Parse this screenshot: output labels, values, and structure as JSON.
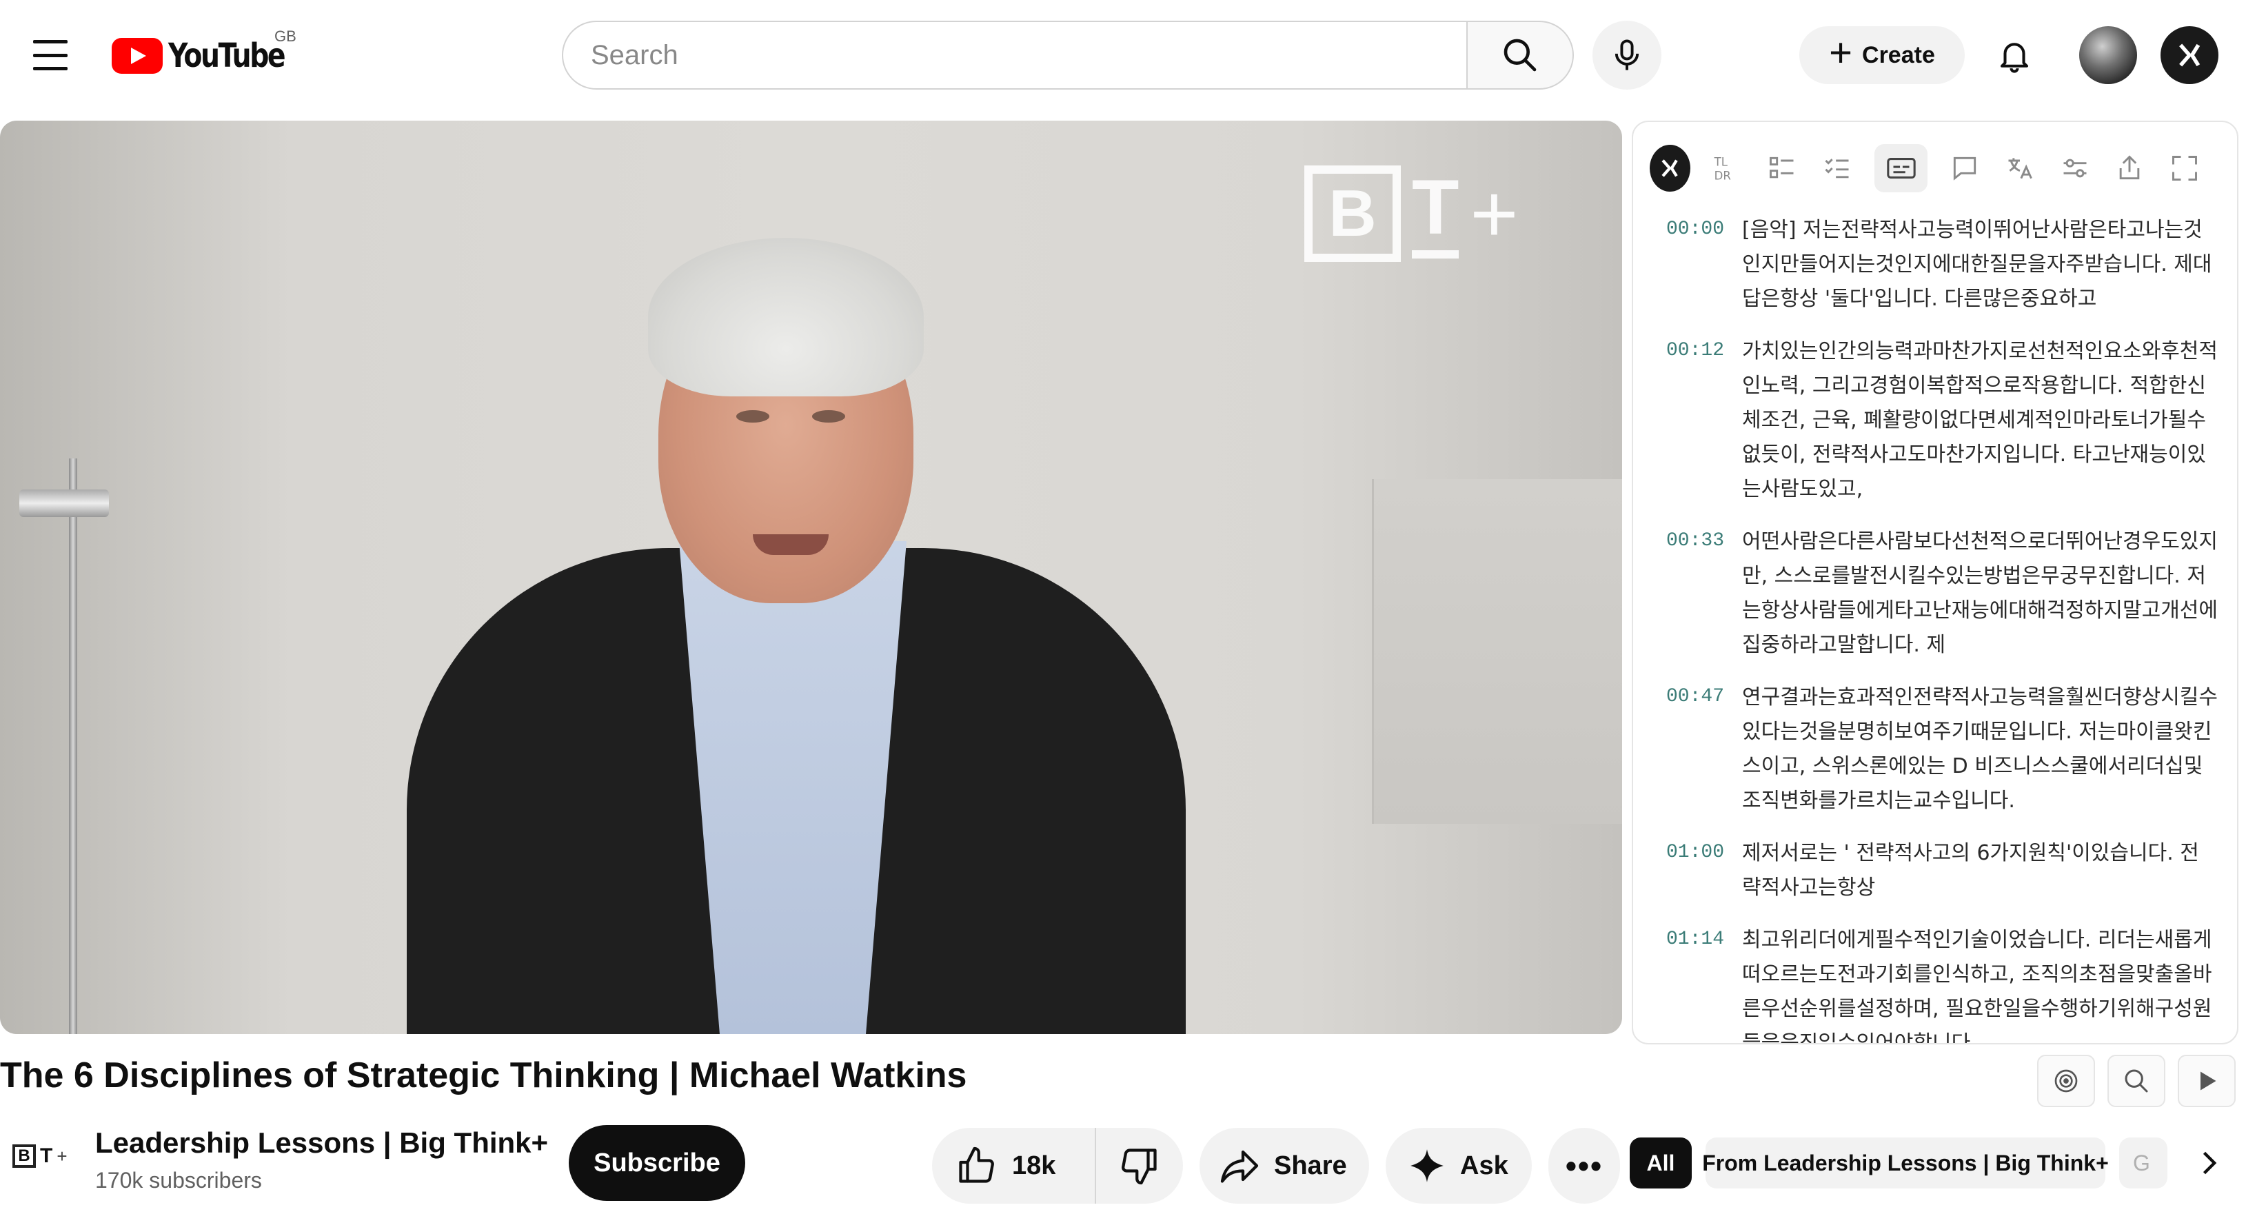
{
  "header": {
    "logo_text": "YouTube",
    "country_code": "GB",
    "search_placeholder": "Search",
    "create_label": "Create"
  },
  "video": {
    "title": "The 6 Disciplines of Strategic Thinking | Michael Watkins",
    "watermark_text": "BT+"
  },
  "channel": {
    "name": "Leadership Lessons | Big Think+",
    "subscribers": "170k subscribers",
    "subscribe_label": "Subscribe"
  },
  "actions": {
    "like_count": "18k",
    "share_label": "Share",
    "ask_label": "Ask",
    "more_label": "•••"
  },
  "chips": {
    "all": "All",
    "from": "From Leadership Lessons | Big Think+",
    "next_partial": "G"
  },
  "transcript": [
    {
      "time": "00:00",
      "text": "[음악] 저는전략적사고능력이뛰어난사람은타고나는것인지만들어지는것인지에대한질문을자주받습니다. 제대답은항상 '둘다'입니다. 다른많은중요하고"
    },
    {
      "time": "00:12",
      "text": "가치있는인간의능력과마찬가지로선천적인요소와후천적인노력, 그리고경험이복합적으로작용합니다. 적합한신체조건, 근육, 폐활량이없다면세계적인마라토너가될수없듯이, 전략적사고도마찬가지입니다. 타고난재능이있는사람도있고,"
    },
    {
      "time": "00:33",
      "text": "어떤사람은다른사람보다선천적으로더뛰어난경우도있지만, 스스로를발전시킬수있는방법은무궁무진합니다. 저는항상사람들에게타고난재능에대해걱정하지말고개선에집중하라고말합니다. 제"
    },
    {
      "time": "00:47",
      "text": "연구결과는효과적인전략적사고능력을훨씬더향상시킬수있다는것을분명히보여주기때문입니다. 저는마이클왓킨스이고, 스위스론에있는 D 비즈니스스쿨에서리더십및조직변화를가르치는교수입니다."
    },
    {
      "time": "01:00",
      "text": "제저서로는 ' 전략적사고의 6가지원칙'이있습니다. 전략적사고는항상"
    },
    {
      "time": "01:14",
      "text": "최고위리더에게필수적인기술이었습니다. 리더는새롭게떠오르는도전과기회를인식하고, 조직의초점을맞출올바른우선순위를설정하며, 필요한일을수행하기위해구성원들을움직일수있어야합니다."
    }
  ],
  "colors": {
    "brand_red": "#ff0000",
    "timestamp_teal": "#3b7c77",
    "chip_dark": "#0f0f0f"
  },
  "icons": {
    "menu": "hamburger-icon",
    "search": "search-icon",
    "mic": "microphone-icon",
    "bell": "notification-bell-icon"
  }
}
